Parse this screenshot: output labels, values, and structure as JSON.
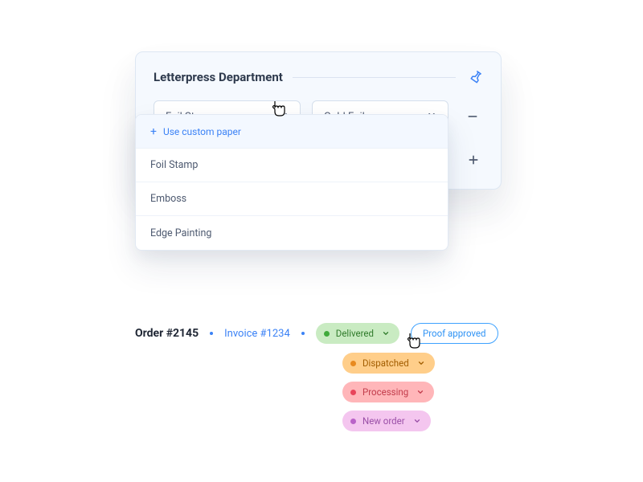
{
  "card": {
    "title": "Letterpress Department",
    "selects": {
      "first": {
        "value": "Foil Stamp"
      },
      "second": {
        "value": "Gold Foil"
      }
    },
    "dropdown": {
      "custom_label": "Use custom paper",
      "items": [
        "Foil Stamp",
        "Emboss",
        "Edge Painting"
      ]
    }
  },
  "order": {
    "title": "Order #2145",
    "invoice": "Invoice #1234",
    "status_current": "Delivered",
    "statuses": {
      "dispatched": "Dispatched",
      "processing": "Processing",
      "new_order": "New order"
    },
    "proof_label": "Proof approved"
  }
}
